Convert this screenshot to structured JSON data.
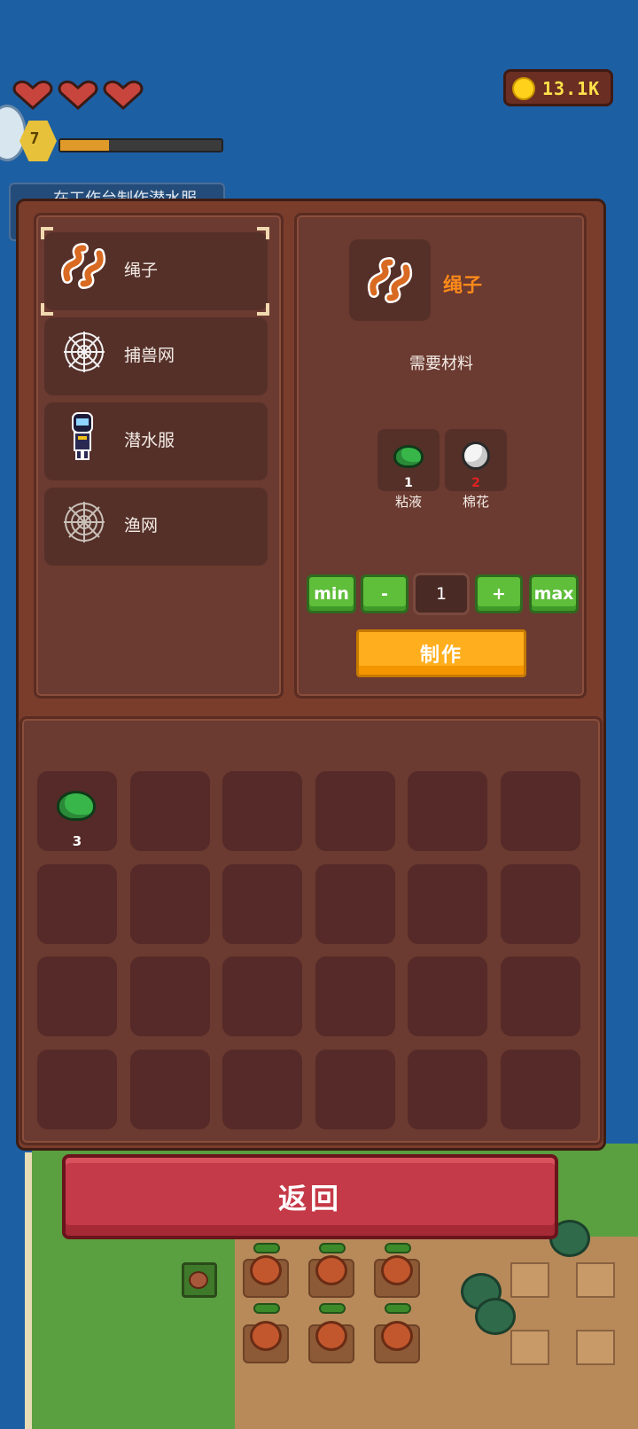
{
  "hud": {
    "hearts": 3,
    "level": "7",
    "xp_fraction": 0.3,
    "quest_text": "在工作台制作潜水服",
    "coins": "13.1K"
  },
  "recipes": [
    {
      "label": "绳子",
      "icon": "rope-icon",
      "selected": true
    },
    {
      "label": "捕兽网",
      "icon": "trap-net-icon",
      "selected": false
    },
    {
      "label": "潜水服",
      "icon": "diving-suit-icon",
      "selected": false
    },
    {
      "label": "渔网",
      "icon": "fishing-net-icon",
      "selected": false
    }
  ],
  "detail": {
    "item_name": "绳子",
    "requirements_title": "需要材料",
    "materials": [
      {
        "name": "粘液",
        "count": "1",
        "icon": "slime-icon",
        "enough": true
      },
      {
        "name": "棉花",
        "count": "2",
        "icon": "cotton-icon",
        "enough": false
      }
    ],
    "quantity": {
      "min_label": "min",
      "minus_label": "-",
      "value": "1",
      "plus_label": "+",
      "max_label": "max"
    },
    "make_label": "制作"
  },
  "inventory": {
    "columns": 6,
    "rows": 4,
    "slots": [
      {
        "icon": "slime-icon",
        "count": "3"
      }
    ]
  },
  "back_label": "返回",
  "colors": {
    "panel": "#6b3a30",
    "button_green": "#5fbe3a",
    "make_orange": "#ffae1e",
    "back_red": "#c53a48",
    "item_name_orange": "#ff8a1a",
    "not_enough_red": "#e22222"
  }
}
